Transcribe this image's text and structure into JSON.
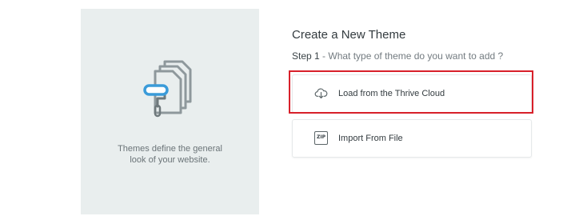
{
  "left_panel": {
    "illustration_icon": "theme-templates-paint-roller-icon",
    "caption_line1": "Themes define the general",
    "caption_line2": "look of your website."
  },
  "main": {
    "title": "Create a New Theme",
    "step_number": "Step 1",
    "step_text": " - What type of theme do you want to add ?",
    "options": [
      {
        "label": "Load from the Thrive Cloud",
        "icon": "cloud-download-icon",
        "highlighted": true
      },
      {
        "label": "Import From File",
        "icon": "zip-file-icon",
        "icon_text": "ZIP",
        "highlighted": false
      }
    ]
  },
  "colors": {
    "panel_bg": "#e9eeee",
    "highlight": "#d8202a",
    "accent_blue": "#3a9bd9"
  }
}
